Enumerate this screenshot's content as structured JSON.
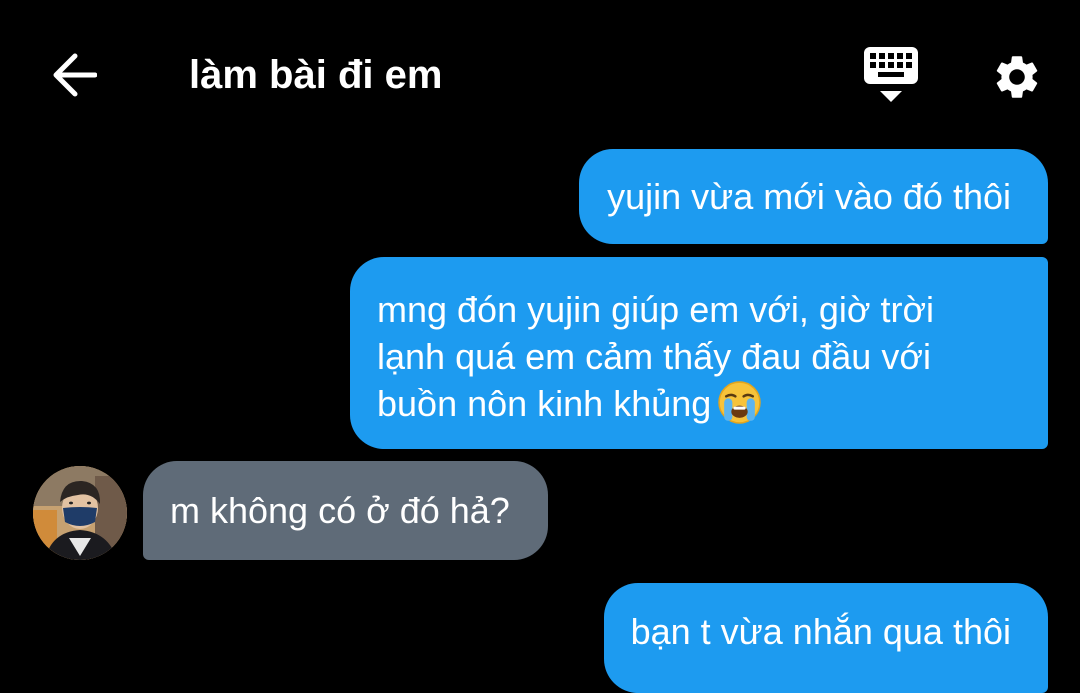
{
  "header": {
    "title": "làm bài đi em",
    "back_icon": "arrow-back-icon",
    "keyboard_icon": "keyboard-icon",
    "settings_icon": "gear-icon"
  },
  "messages": [
    {
      "direction": "outgoing",
      "text": "yujin vừa mới vào đó thôi"
    },
    {
      "direction": "outgoing",
      "lines": [
        "mng đón yujin giúp em với, giờ trời",
        "lạnh quá em cảm thấy đau đầu với",
        "buồn nôn kinh khủng"
      ],
      "emoji": "loudly-crying-face-icon"
    },
    {
      "direction": "incoming",
      "text": "m không có ở đó hả?",
      "avatar": "avatar"
    },
    {
      "direction": "outgoing",
      "text": "bạn t vừa nhắn qua thôi"
    }
  ],
  "colors": {
    "background": "#000000",
    "outgoing_bubble": "#1d9bf0",
    "incoming_bubble": "#5f6b78",
    "text": "#ffffff"
  }
}
